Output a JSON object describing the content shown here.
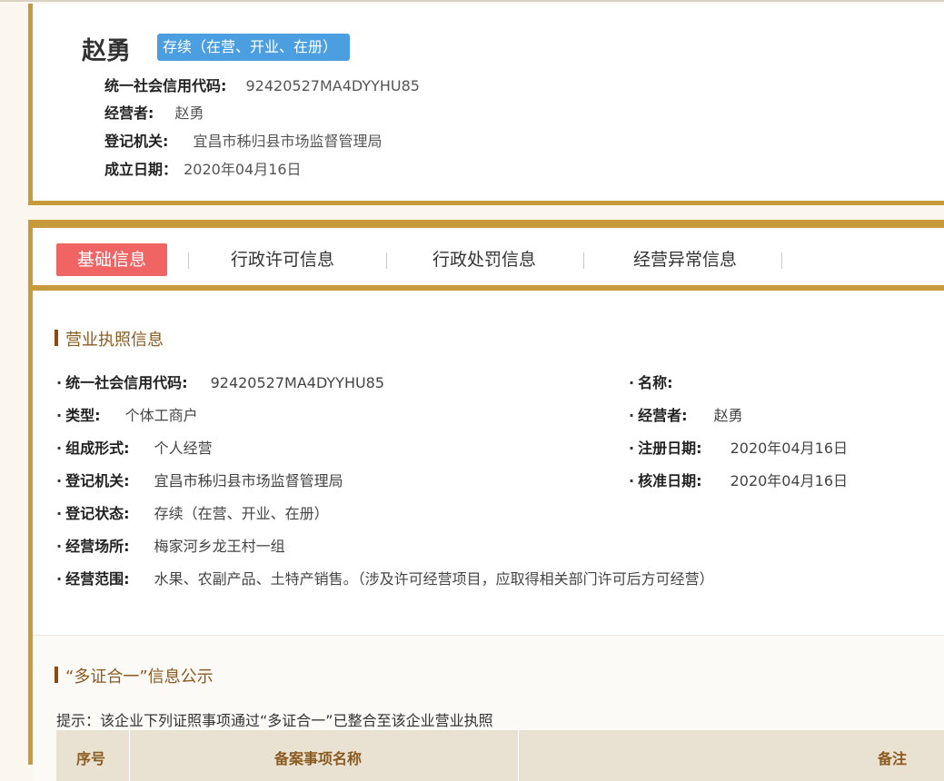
{
  "header": {
    "name": "赵勇",
    "status_badge": "存续（在营、开业、在册）",
    "fields": [
      {
        "label": "统一社会信用代码:",
        "value": "92420527MA4DYYHU85"
      },
      {
        "label": "经营者:",
        "value": "赵勇"
      },
      {
        "label": "登记机关:",
        "value": "宜昌市秭归县市场监督管理局"
      },
      {
        "label": "成立日期：",
        "value": "2020年04月16日"
      }
    ]
  },
  "tabs": [
    {
      "label": "基础信息",
      "active": true
    },
    {
      "label": "行政许可信息",
      "active": false
    },
    {
      "label": "行政处罚信息",
      "active": false
    },
    {
      "label": "经营异常信息",
      "active": false
    }
  ],
  "license": {
    "title": "营业执照信息",
    "left_fields": [
      {
        "label": "统一社会信用代码:",
        "value": "92420527MA4DYYHU85"
      },
      {
        "label": "类型:",
        "value": "个体工商户"
      },
      {
        "label": "组成形式:",
        "value": "个人经营"
      },
      {
        "label": "登记机关:",
        "value": "宜昌市秭归县市场监督管理局"
      },
      {
        "label": "登记状态:",
        "value": "存续（在营、开业、在册）"
      },
      {
        "label": "经营场所:",
        "value": "梅家河乡龙王村一组"
      },
      {
        "label": "经营范围:",
        "value": "水果、农副产品、土特产销售。（涉及许可经营项目，应取得相关部门许可后方可经营）"
      }
    ],
    "right_fields": [
      {
        "label": "名称:",
        "value": ""
      },
      {
        "label": "经营者:",
        "value": "赵勇"
      },
      {
        "label": "注册日期:",
        "value": "2020年04月16日"
      },
      {
        "label": "核准日期:",
        "value": "2020年04月16日"
      }
    ]
  },
  "multi_cert": {
    "title": "“多证合一”信息公示",
    "note": "提示：该企业下列证照事项通过“多证合一”已整合至该企业营业执照",
    "columns": [
      "序号",
      "备案事项名称",
      "备注"
    ]
  },
  "colors": {
    "gold": "#c79a3c",
    "badge_blue": "#4b9fe1",
    "active_tab_red": "#f06464",
    "section_brown": "#8b5a1f"
  }
}
